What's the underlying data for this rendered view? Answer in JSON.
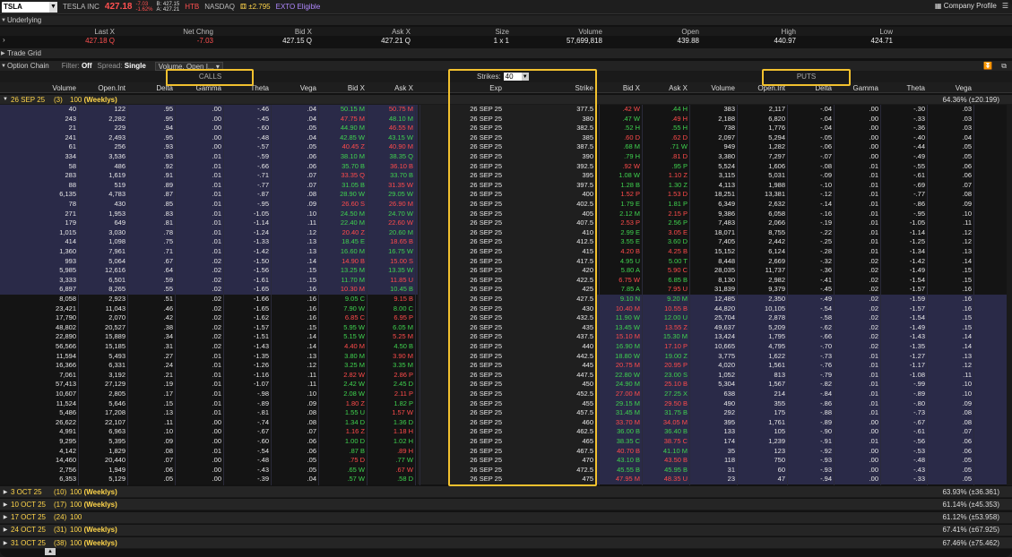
{
  "topbar": {
    "symbol": "TSLA",
    "company": "TESLA INC",
    "price": "427.18",
    "change": "-7.03",
    "change_pct": "-1.62%",
    "bid": "B: 427.15",
    "ask": "A: 427.21",
    "htb": "HTB",
    "exchange": "NASDAQ",
    "expected_move": "±2.795",
    "exto": "EXTO Eligible",
    "company_profile": "Company Profile"
  },
  "underlying": {
    "title": "Underlying",
    "headers": [
      "Last X",
      "Net Chng",
      "Bid X",
      "Ask X",
      "Size",
      "Volume",
      "Open",
      "High",
      "Low"
    ],
    "values": [
      "427.18 Q",
      "-7.03",
      "427.15 Q",
      "427.21 Q",
      "1 x 1",
      "57,699,818",
      "439.88",
      "440.97",
      "424.71"
    ]
  },
  "trade_grid": "Trade Grid",
  "option_chain": {
    "title": "Option Chain",
    "filter_label": "Filter:",
    "filter_value": "Off",
    "spread_label": "Spread:",
    "spread_value": "Single",
    "layout_value": "Volume, Open I..."
  },
  "banner": {
    "calls": "CALLS",
    "puts": "PUTS",
    "strikes_label": "Strikes:",
    "strikes_value": "40"
  },
  "columns": {
    "calls": [
      "Volume",
      "Open.Int",
      "Delta",
      "Gamma",
      "Theta",
      "Vega",
      "Bid X",
      "Ask X"
    ],
    "mid": [
      "Exp",
      "Strike"
    ],
    "puts": [
      "Bid X",
      "Ask X",
      "Volume",
      "Open.Int",
      "Delta",
      "Gamma",
      "Theta",
      "Vega"
    ]
  },
  "main_expiration": {
    "date": "26 SEP 25",
    "count": "(3)",
    "mult": "100",
    "type": "(Weeklys)",
    "iv": "64.36% (±20.199)"
  },
  "rows": [
    {
      "c": [
        "40",
        "122",
        ".95",
        ".00",
        "-.46",
        ".04",
        "50.15 M",
        "50.75 M"
      ],
      "exp": "26 SEP 25",
      "strike": "377.5",
      "p": [
        ".42 W",
        ".44 H",
        "383",
        "2,117",
        "-.04",
        ".00",
        "-.30",
        ".03"
      ]
    },
    {
      "c": [
        "243",
        "2,282",
        ".95",
        ".00",
        "-.45",
        ".04",
        "47.75 M",
        "48.10 M"
      ],
      "exp": "26 SEP 25",
      "strike": "380",
      "p": [
        ".47 W",
        ".49 H",
        "2,188",
        "6,820",
        "-.04",
        ".00",
        "-.33",
        ".03"
      ]
    },
    {
      "c": [
        "21",
        "229",
        ".94",
        ".00",
        "-.60",
        ".05",
        "44.90 M",
        "46.55 M"
      ],
      "exp": "26 SEP 25",
      "strike": "382.5",
      "p": [
        ".52 H",
        ".55 H",
        "738",
        "1,776",
        "-.04",
        ".00",
        "-.36",
        ".03"
      ]
    },
    {
      "c": [
        "241",
        "2,493",
        ".95",
        ".00",
        "-.48",
        ".04",
        "42.85 W",
        "43.15 W"
      ],
      "exp": "26 SEP 25",
      "strike": "385",
      "p": [
        ".60 D",
        ".62 D",
        "2,097",
        "5,294",
        "-.05",
        ".00",
        "-.40",
        ".04"
      ]
    },
    {
      "c": [
        "61",
        "256",
        ".93",
        ".00",
        "-.57",
        ".05",
        "40.45 Z",
        "40.90 M"
      ],
      "exp": "26 SEP 25",
      "strike": "387.5",
      "p": [
        ".68 M",
        ".71 W",
        "949",
        "1,282",
        "-.06",
        ".00",
        "-.44",
        ".05"
      ]
    },
    {
      "c": [
        "334",
        "3,536",
        ".93",
        ".01",
        "-.59",
        ".06",
        "38.10 M",
        "38.35 Q"
      ],
      "exp": "26 SEP 25",
      "strike": "390",
      "p": [
        ".79 H",
        ".81 D",
        "3,380",
        "7,297",
        "-.07",
        ".00",
        "-.49",
        ".05"
      ]
    },
    {
      "c": [
        "58",
        "486",
        ".92",
        ".01",
        "-.66",
        ".06",
        "35.70 B",
        "36.10 B"
      ],
      "exp": "26 SEP 25",
      "strike": "392.5",
      "p": [
        ".92 W",
        ".95 P",
        "5,524",
        "1,606",
        "-.08",
        ".01",
        "-.55",
        ".06"
      ]
    },
    {
      "c": [
        "283",
        "1,619",
        ".91",
        ".01",
        "-.71",
        ".07",
        "33.35 Q",
        "33.70 B"
      ],
      "exp": "26 SEP 25",
      "strike": "395",
      "p": [
        "1.08 W",
        "1.10 Z",
        "3,115",
        "5,031",
        "-.09",
        ".01",
        "-.61",
        ".06"
      ]
    },
    {
      "c": [
        "88",
        "519",
        ".89",
        ".01",
        "-.77",
        ".07",
        "31.05 B",
        "31.35 W"
      ],
      "exp": "26 SEP 25",
      "strike": "397.5",
      "p": [
        "1.28 B",
        "1.30 Z",
        "4,113",
        "1,988",
        "-.10",
        ".01",
        "-.69",
        ".07"
      ]
    },
    {
      "c": [
        "6,135",
        "4,783",
        ".87",
        ".01",
        "-.87",
        ".08",
        "28.90 W",
        "29.05 W"
      ],
      "exp": "26 SEP 25",
      "strike": "400",
      "p": [
        "1.52 P",
        "1.53 D",
        "18,251",
        "13,381",
        "-.12",
        ".01",
        "-.77",
        ".08"
      ]
    },
    {
      "c": [
        "78",
        "430",
        ".85",
        ".01",
        "-.95",
        ".09",
        "26.60 S",
        "26.90 M"
      ],
      "exp": "26 SEP 25",
      "strike": "402.5",
      "p": [
        "1.79 E",
        "1.81 P",
        "6,349",
        "2,632",
        "-.14",
        ".01",
        "-.86",
        ".09"
      ]
    },
    {
      "c": [
        "271",
        "1,953",
        ".83",
        ".01",
        "-1.05",
        ".10",
        "24.50 M",
        "24.70 W"
      ],
      "exp": "26 SEP 25",
      "strike": "405",
      "p": [
        "2.12 M",
        "2.15 P",
        "9,386",
        "6,058",
        "-.16",
        ".01",
        "-.95",
        ".10"
      ]
    },
    {
      "c": [
        "179",
        "649",
        ".81",
        ".01",
        "-1.14",
        ".11",
        "22.40 M",
        "22.60 W"
      ],
      "exp": "26 SEP 25",
      "strike": "407.5",
      "p": [
        "2.53 P",
        "2.56 P",
        "7,483",
        "2,066",
        "-.19",
        ".01",
        "-1.05",
        ".11"
      ]
    },
    {
      "c": [
        "1,015",
        "3,030",
        ".78",
        ".01",
        "-1.24",
        ".12",
        "20.40 Z",
        "20.60 M"
      ],
      "exp": "26 SEP 25",
      "strike": "410",
      "p": [
        "2.99 E",
        "3.05 E",
        "18,071",
        "8,755",
        "-.22",
        ".01",
        "-1.14",
        ".12"
      ]
    },
    {
      "c": [
        "414",
        "1,098",
        ".75",
        ".01",
        "-1.33",
        ".13",
        "18.45 E",
        "18.65 B"
      ],
      "exp": "26 SEP 25",
      "strike": "412.5",
      "p": [
        "3.55 E",
        "3.60 D",
        "7,405",
        "2,442",
        "-.25",
        ".01",
        "-1.25",
        ".12"
      ]
    },
    {
      "c": [
        "1,360",
        "7,961",
        ".71",
        ".01",
        "-1.42",
        ".13",
        "16.60 M",
        "16.75 W"
      ],
      "exp": "26 SEP 25",
      "strike": "415",
      "p": [
        "4.20 B",
        "4.25 B",
        "15,152",
        "6,124",
        "-.28",
        ".01",
        "-1.34",
        ".13"
      ]
    },
    {
      "c": [
        "993",
        "5,064",
        ".67",
        ".02",
        "-1.50",
        ".14",
        "14.90 B",
        "15.00 S"
      ],
      "exp": "26 SEP 25",
      "strike": "417.5",
      "p": [
        "4.95 U",
        "5.00 T",
        "8,448",
        "2,669",
        "-.32",
        ".02",
        "-1.42",
        ".14"
      ]
    },
    {
      "c": [
        "5,985",
        "12,616",
        ".64",
        ".02",
        "-1.56",
        ".15",
        "13.25 M",
        "13.35 W"
      ],
      "exp": "26 SEP 25",
      "strike": "420",
      "p": [
        "5.80 A",
        "5.90 C",
        "28,035",
        "11,737",
        "-.36",
        ".02",
        "-1.49",
        ".15"
      ]
    },
    {
      "c": [
        "3,333",
        "6,501",
        ".59",
        ".02",
        "-1.61",
        ".15",
        "11.70 M",
        "11.85 U"
      ],
      "exp": "26 SEP 25",
      "strike": "422.5",
      "p": [
        "6.75 W",
        "6.85 B",
        "8,130",
        "2,982",
        "-.41",
        ".02",
        "-1.54",
        ".15"
      ]
    },
    {
      "c": [
        "6,897",
        "8,265",
        ".55",
        ".02",
        "-1.65",
        ".16",
        "10.30 M",
        "10.45 B"
      ],
      "exp": "26 SEP 25",
      "strike": "425",
      "p": [
        "7.85 A",
        "7.95 U",
        "31,839",
        "9,379",
        "-.45",
        ".02",
        "-1.57",
        ".16"
      ]
    },
    {
      "c": [
        "8,058",
        "2,923",
        ".51",
        ".02",
        "-1.66",
        ".16",
        "9.05 C",
        "9.15 B"
      ],
      "exp": "26 SEP 25",
      "strike": "427.5",
      "p": [
        "9.10 N",
        "9.20 M",
        "12,485",
        "2,350",
        "-.49",
        ".02",
        "-1.59",
        ".16"
      ]
    },
    {
      "c": [
        "23,421",
        "11,043",
        ".46",
        ".02",
        "-1.65",
        ".16",
        "7.90 W",
        "8.00 C"
      ],
      "exp": "26 SEP 25",
      "strike": "430",
      "p": [
        "10.40 M",
        "10.55 B",
        "44,820",
        "10,105",
        "-.54",
        ".02",
        "-1.57",
        ".16"
      ]
    },
    {
      "c": [
        "17,790",
        "2,070",
        ".42",
        ".02",
        "-1.62",
        ".16",
        "6.85 C",
        "6.95 P"
      ],
      "exp": "26 SEP 25",
      "strike": "432.5",
      "p": [
        "11.90 W",
        "12.00 U",
        "25,704",
        "2,878",
        "-.58",
        ".02",
        "-1.54",
        ".15"
      ]
    },
    {
      "c": [
        "48,802",
        "20,527",
        ".38",
        ".02",
        "-1.57",
        ".15",
        "5.95 W",
        "6.05 M"
      ],
      "exp": "26 SEP 25",
      "strike": "435",
      "p": [
        "13.45 W",
        "13.55 Z",
        "49,637",
        "5,209",
        "-.62",
        ".02",
        "-1.49",
        ".15"
      ]
    },
    {
      "c": [
        "22,890",
        "15,889",
        ".34",
        ".02",
        "-1.51",
        ".14",
        "5.15 W",
        "5.25 M"
      ],
      "exp": "26 SEP 25",
      "strike": "437.5",
      "p": [
        "15.10 M",
        "15.30 M",
        "13,424",
        "1,795",
        "-.66",
        ".02",
        "-1.43",
        ".14"
      ]
    },
    {
      "c": [
        "56,566",
        "15,185",
        ".31",
        ".02",
        "-1.43",
        ".14",
        "4.40 M",
        "4.50 B"
      ],
      "exp": "26 SEP 25",
      "strike": "440",
      "p": [
        "16.90 M",
        "17.10 P",
        "10,665",
        "4,795",
        "-.70",
        ".02",
        "-1.35",
        ".14"
      ]
    },
    {
      "c": [
        "11,594",
        "5,493",
        ".27",
        ".01",
        "-1.35",
        ".13",
        "3.80 M",
        "3.90 M"
      ],
      "exp": "26 SEP 25",
      "strike": "442.5",
      "p": [
        "18.80 W",
        "19.00 Z",
        "3,775",
        "1,622",
        "-.73",
        ".01",
        "-1.27",
        ".13"
      ]
    },
    {
      "c": [
        "16,366",
        "6,331",
        ".24",
        ".01",
        "-1.26",
        ".12",
        "3.25 M",
        "3.35 M"
      ],
      "exp": "26 SEP 25",
      "strike": "445",
      "p": [
        "20.75 M",
        "20.95 P",
        "4,020",
        "1,561",
        "-.76",
        ".01",
        "-1.17",
        ".12"
      ]
    },
    {
      "c": [
        "7,061",
        "3,192",
        ".21",
        ".01",
        "-1.16",
        ".11",
        "2.82 W",
        "2.86 P"
      ],
      "exp": "26 SEP 25",
      "strike": "447.5",
      "p": [
        "22.80 W",
        "23.00 S",
        "1,052",
        "813",
        "-.79",
        ".01",
        "-1.08",
        ".11"
      ]
    },
    {
      "c": [
        "57,413",
        "27,129",
        ".19",
        ".01",
        "-1.07",
        ".11",
        "2.42 W",
        "2.45 D"
      ],
      "exp": "26 SEP 25",
      "strike": "450",
      "p": [
        "24.90 M",
        "25.10 B",
        "5,304",
        "1,567",
        "-.82",
        ".01",
        "-.99",
        ".10"
      ]
    },
    {
      "c": [
        "10,607",
        "2,805",
        ".17",
        ".01",
        "-.98",
        ".10",
        "2.08 W",
        "2.11 P"
      ],
      "exp": "26 SEP 25",
      "strike": "452.5",
      "p": [
        "27.00 M",
        "27.25 X",
        "638",
        "214",
        "-.84",
        ".01",
        "-.89",
        ".10"
      ]
    },
    {
      "c": [
        "11,524",
        "5,646",
        ".15",
        ".01",
        "-.89",
        ".09",
        "1.80 Z",
        "1.82 P"
      ],
      "exp": "26 SEP 25",
      "strike": "455",
      "p": [
        "29.15 M",
        "29.50 B",
        "490",
        "355",
        "-.86",
        ".01",
        "-.80",
        ".09"
      ]
    },
    {
      "c": [
        "5,486",
        "17,208",
        ".13",
        ".01",
        "-.81",
        ".08",
        "1.55 U",
        "1.57 W"
      ],
      "exp": "26 SEP 25",
      "strike": "457.5",
      "p": [
        "31.45 M",
        "31.75 B",
        "292",
        "175",
        "-.88",
        ".01",
        "-.73",
        ".08"
      ]
    },
    {
      "c": [
        "26,622",
        "22,107",
        ".11",
        ".00",
        "-.74",
        ".08",
        "1.34 D",
        "1.36 D"
      ],
      "exp": "26 SEP 25",
      "strike": "460",
      "p": [
        "33.70 M",
        "34.05 M",
        "395",
        "1,761",
        "-.89",
        ".00",
        "-.67",
        ".08"
      ]
    },
    {
      "c": [
        "4,991",
        "6,963",
        ".10",
        ".00",
        "-.67",
        ".07",
        "1.16 Z",
        "1.18 H"
      ],
      "exp": "26 SEP 25",
      "strike": "462.5",
      "p": [
        "36.00 B",
        "36.40 B",
        "133",
        "105",
        "-.90",
        ".00",
        "-.61",
        ".07"
      ]
    },
    {
      "c": [
        "9,295",
        "5,395",
        ".09",
        ".00",
        "-.60",
        ".06",
        "1.00 D",
        "1.02 H"
      ],
      "exp": "26 SEP 25",
      "strike": "465",
      "p": [
        "38.35 C",
        "38.75 C",
        "174",
        "1,239",
        "-.91",
        ".01",
        "-.56",
        ".06"
      ]
    },
    {
      "c": [
        "4,142",
        "1,829",
        ".08",
        ".01",
        "-.54",
        ".06",
        ".87 B",
        ".89 H"
      ],
      "exp": "26 SEP 25",
      "strike": "467.5",
      "p": [
        "40.70 B",
        "41.10 M",
        "35",
        "123",
        "-.92",
        ".00",
        "-.53",
        ".06"
      ]
    },
    {
      "c": [
        "14,460",
        "20,440",
        ".07",
        ".00",
        "-.48",
        ".05",
        ".75 D",
        ".77 W"
      ],
      "exp": "26 SEP 25",
      "strike": "470",
      "p": [
        "43.10 B",
        "43.50 B",
        "118",
        "750",
        "-.93",
        ".00",
        "-.48",
        ".05"
      ]
    },
    {
      "c": [
        "2,756",
        "1,949",
        ".06",
        ".00",
        "-.43",
        ".05",
        ".65 W",
        ".67 W"
      ],
      "exp": "26 SEP 25",
      "strike": "472.5",
      "p": [
        "45.55 B",
        "45.95 B",
        "31",
        "60",
        "-.93",
        ".00",
        "-.43",
        ".05"
      ]
    },
    {
      "c": [
        "6,353",
        "5,129",
        ".05",
        ".00",
        "-.39",
        ".04",
        ".57 W",
        ".58 D"
      ],
      "exp": "26 SEP 25",
      "strike": "475",
      "p": [
        "47.95 M",
        "48.35 U",
        "23",
        "47",
        "-.94",
        ".00",
        "-.33",
        ".05"
      ]
    }
  ],
  "other_expirations": [
    {
      "date": "3 OCT 25",
      "count": "(10)",
      "mult": "100",
      "type": "(Weeklys)",
      "iv": "63.93% (±36.361)"
    },
    {
      "date": "10 OCT 25",
      "count": "(17)",
      "mult": "100",
      "type": "(Weeklys)",
      "iv": "61.14% (±45.353)"
    },
    {
      "date": "17 OCT 25",
      "count": "(24)",
      "mult": "100",
      "type": "",
      "iv": "61.12% (±53.958)"
    },
    {
      "date": "24 OCT 25",
      "count": "(31)",
      "mult": "100",
      "type": "(Weeklys)",
      "iv": "67.41% (±67.925)"
    },
    {
      "date": "31 OCT 25",
      "count": "(38)",
      "mult": "100",
      "type": "(Weeklys)",
      "iv": "67.46% (±75.462)"
    }
  ],
  "colors": {
    "accent": "#f2c12e",
    "green": "#3fd34f",
    "red": "#ff4b4b",
    "itm": "#2a2a48"
  }
}
